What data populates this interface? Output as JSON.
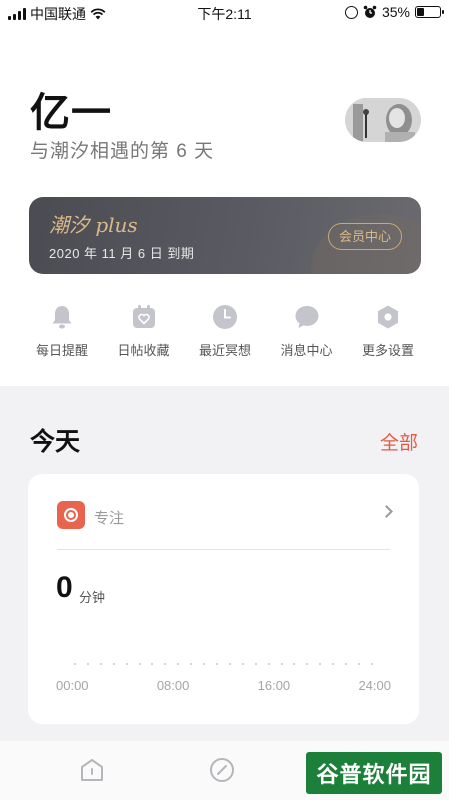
{
  "status_bar": {
    "carrier": "中国联通",
    "time": "下午2:11",
    "battery_percent": "35%",
    "battery_level": 0.35
  },
  "profile": {
    "name": "亿一",
    "subtitle": "与潮汐相遇的第 6 天"
  },
  "member_card": {
    "title": "潮汐 plus",
    "expiry": "2020 年 11 月 6 日 到期",
    "button": "会员中心"
  },
  "quick_actions": [
    {
      "label": "每日提醒",
      "icon": "bell-icon"
    },
    {
      "label": "日帖收藏",
      "icon": "calendar-heart-icon"
    },
    {
      "label": "最近冥想",
      "icon": "clock-icon"
    },
    {
      "label": "消息中心",
      "icon": "chat-bubble-icon"
    },
    {
      "label": "更多设置",
      "icon": "settings-hexagon-icon"
    }
  ],
  "today": {
    "title": "今天",
    "see_all": "全部"
  },
  "focus_card": {
    "label": "专注",
    "value": "0",
    "unit": "分钟",
    "time_axis": [
      "00:00",
      "08:00",
      "16:00",
      "24:00"
    ]
  },
  "tab_bar": {
    "tabs": [
      {
        "icon": "home-icon"
      },
      {
        "icon": "compass-icon"
      }
    ]
  },
  "watermark": {
    "text": "谷普软件园"
  },
  "colors": {
    "accent": "#e25b45",
    "focus_icon": "#e8644f",
    "member_gold": "#d9b98a",
    "member_card_bg": "#4b4b52",
    "icon_gray": "#c4c4cc",
    "watermark_bg": "#1c7f3a"
  }
}
